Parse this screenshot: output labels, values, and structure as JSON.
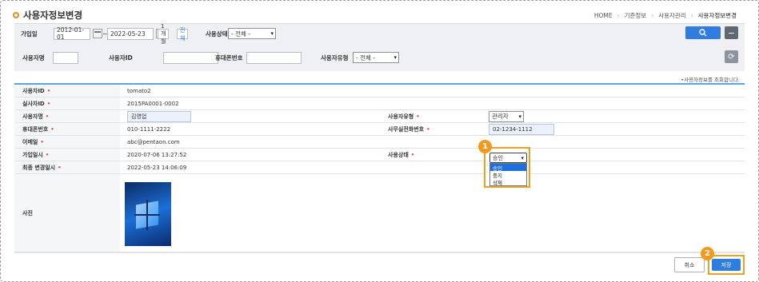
{
  "page": {
    "title": "사용자정보변경"
  },
  "breadcrumb": [
    "HOME",
    "기준정보",
    "사용자관리",
    "사용자정보변경"
  ],
  "search": {
    "join_label": "가입일",
    "date_from": "2012-01-01",
    "date_to": "2022-05-23",
    "tilde": "~",
    "btn_1month": "1개월",
    "btn_all": "전체",
    "status_label": "사용상태",
    "status_value": "- 전체 -",
    "name_label": "사용자명",
    "id_label": "사용자ID",
    "phone_label": "휴대폰번호",
    "type_label": "사용자유형",
    "type_value": "- 전체 -"
  },
  "notice": "•사용자정보를 조회합니다.",
  "detail": {
    "user_id_label": "사용자ID",
    "user_id": "tomato2",
    "emp_id_label": "실사자ID",
    "emp_id": "2015PA0001-0002",
    "name_label": "사용자명",
    "name": "김영업",
    "user_type_label": "사용자유형",
    "user_type": "관리자",
    "mobile_label": "휴대폰번호",
    "mobile": "010-1111-2222",
    "office_phone_label": "사무실전화번호",
    "office_phone": "02-1234-1112",
    "email_label": "이메일",
    "email": "abc@pentaon.com",
    "join_date_label": "가입일시",
    "join_date": "2020-07-06 13:27:52",
    "status_label": "사용상태",
    "last_modified_label": "최종 변경일시",
    "last_modified": "2022-05-23 14:06:09",
    "photo_label": "사진"
  },
  "status_dropdown": {
    "selected": "승인",
    "options": [
      "승인",
      "중지",
      "삭제"
    ]
  },
  "markers": {
    "one": "1",
    "two": "2"
  },
  "buttons": {
    "cancel": "취소",
    "save": "저장"
  },
  "colors": {
    "accent": "#2f7de0",
    "highlight": "#f0a020",
    "title_dot": "#f08a1c"
  }
}
